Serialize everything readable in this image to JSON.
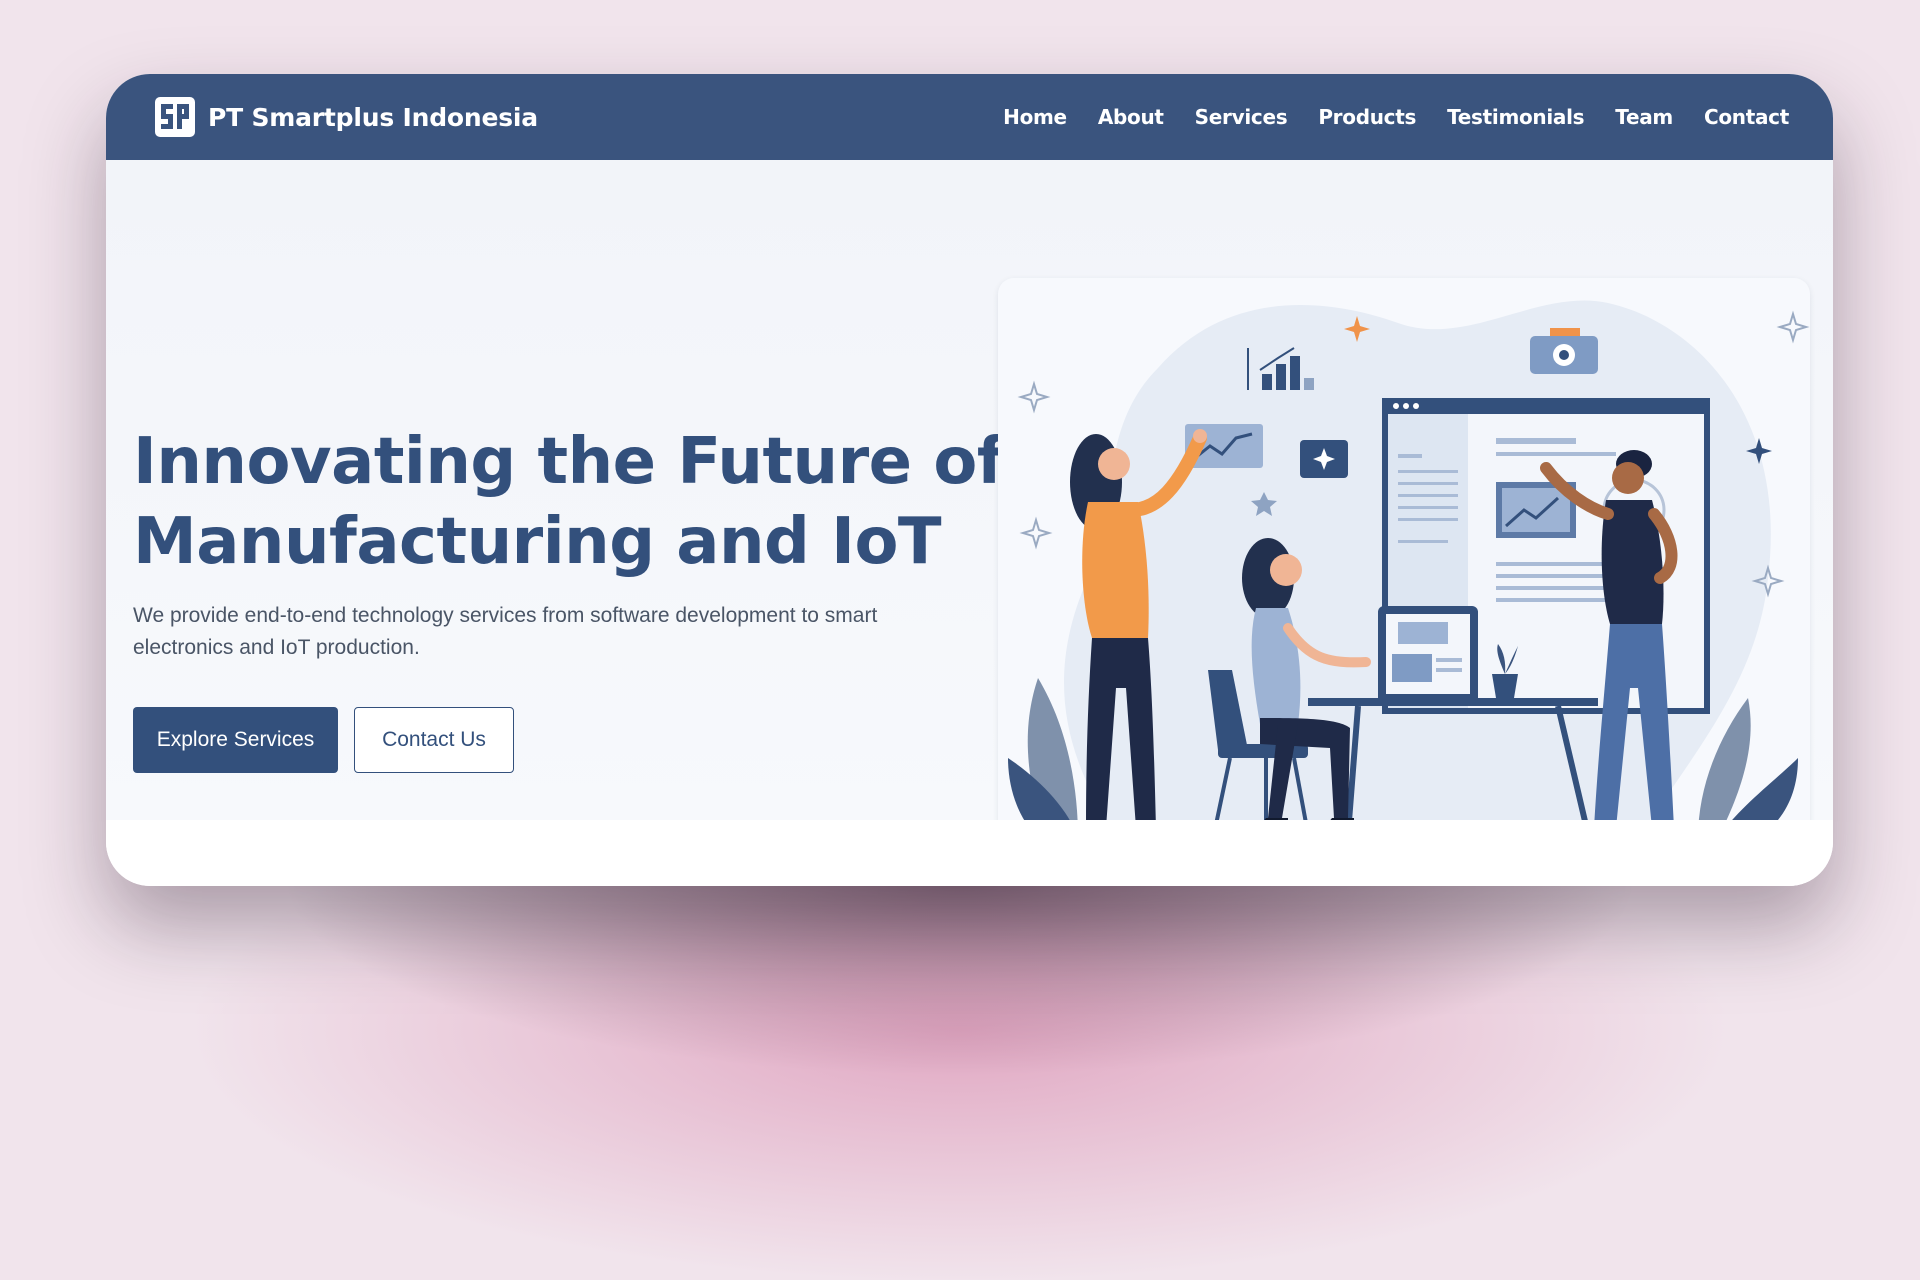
{
  "brand": {
    "name": "PT Smartplus Indonesia",
    "logo_icon": "smartplus-logo-icon"
  },
  "nav": {
    "items": [
      {
        "label": "Home"
      },
      {
        "label": "About"
      },
      {
        "label": "Services"
      },
      {
        "label": "Products"
      },
      {
        "label": "Testimonials"
      },
      {
        "label": "Team"
      },
      {
        "label": "Contact"
      }
    ]
  },
  "hero": {
    "title_line1": "Innovating the Future of",
    "title_line2": "Manufacturing and IoT",
    "description": "We provide end-to-end technology services from software development to smart electronics and IoT production.",
    "primary_button": "Explore Services",
    "secondary_button": "Contact Us"
  },
  "colors": {
    "primary": "#3a547e",
    "heading": "#33507c",
    "text": "#4a5566",
    "accent_orange": "#f0934a",
    "background": "#f1e4ec"
  }
}
